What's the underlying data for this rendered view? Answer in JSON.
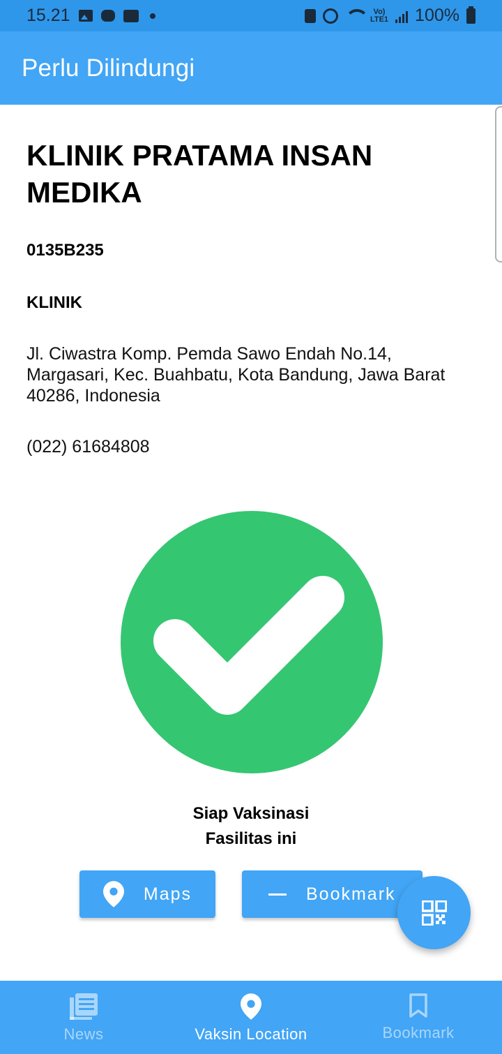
{
  "status_bar": {
    "time": "15.21",
    "battery": "100%",
    "network_label": "LTE1"
  },
  "app_bar": {
    "title": "Perlu Dilindungi"
  },
  "facility": {
    "name": "KLINIK PRATAMA INSAN MEDIKA",
    "code": "0135B235",
    "type": "KLINIK",
    "address": "Jl. Ciwastra Komp. Pemda Sawo Endah No.14, Margasari, Kec. Buahbatu, Kota Bandung, Jawa Barat 40286, Indonesia",
    "phone": "(022) 61684808"
  },
  "vaccination_status": {
    "line1": "Siap Vaksinasi",
    "line2": "Fasilitas ini",
    "icon": "check-circle-icon",
    "color": "#35c672"
  },
  "actions": {
    "maps_label": "Maps",
    "bookmark_label": "Bookmark",
    "fab_icon": "qr-code-icon"
  },
  "bottom_nav": {
    "items": [
      {
        "label": "News",
        "icon": "news-icon",
        "active": false
      },
      {
        "label": "Vaksin Location",
        "icon": "location-pin-icon",
        "active": true
      },
      {
        "label": "Bookmark",
        "icon": "bookmark-icon",
        "active": false
      }
    ]
  },
  "colors": {
    "primary": "#42a5f5",
    "status_bar": "#2e97ea",
    "success": "#35c672"
  }
}
